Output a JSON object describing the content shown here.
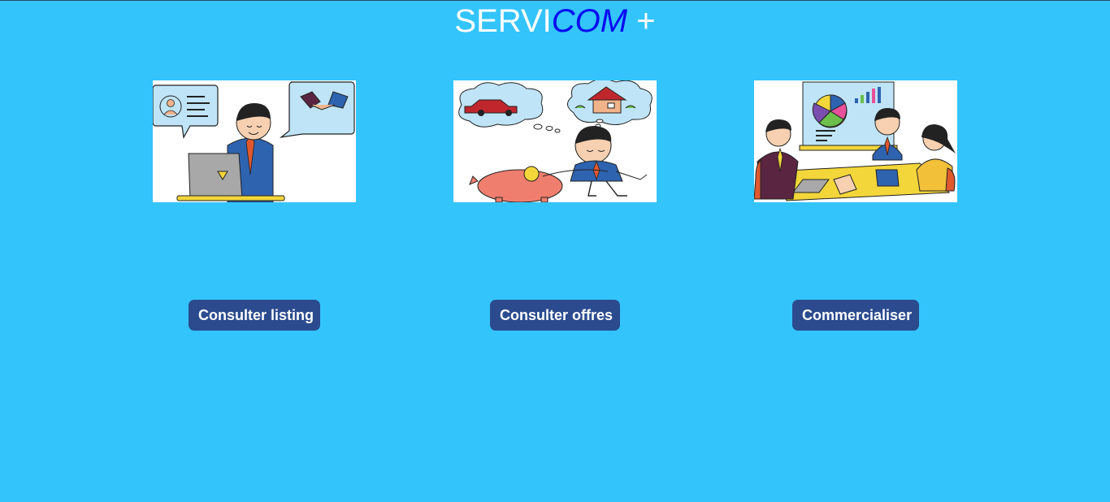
{
  "header": {
    "title_part1": "SERVI",
    "title_part2": "COM",
    "title_part3": " +"
  },
  "cards": [
    {
      "button_label": "Consulter listing",
      "icon": "salesman-laptop-handshake-illustration"
    },
    {
      "button_label": "Consulter offres",
      "icon": "piggy-bank-dreams-illustration"
    },
    {
      "button_label": "Commercialiser",
      "icon": "business-meeting-presentation-illustration"
    }
  ],
  "colors": {
    "background": "#33c4fc",
    "button": "#2b4b8e",
    "title_accent": "#0a0af0"
  }
}
